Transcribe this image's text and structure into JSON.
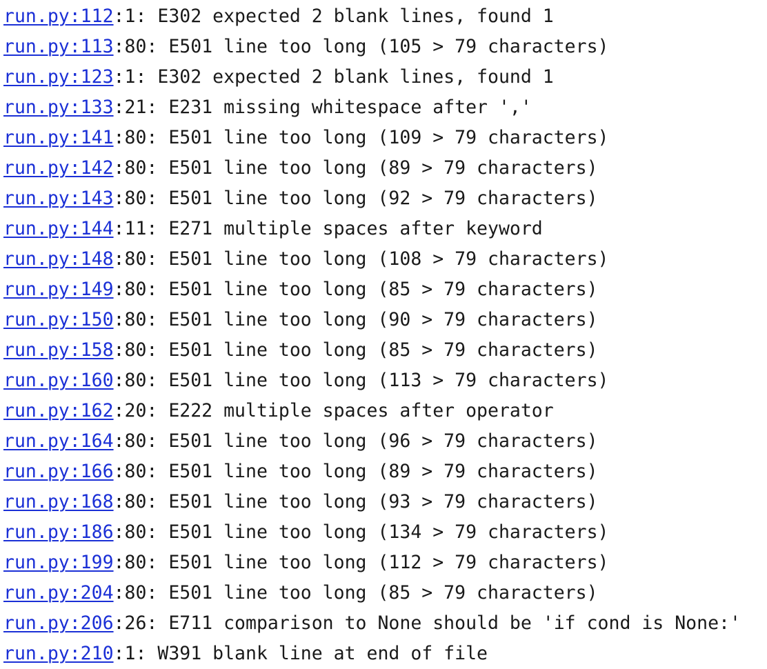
{
  "colors": {
    "link": "#1a2fd6",
    "text": "#1a1a1a",
    "background": "#ffffff"
  },
  "lines": [
    {
      "file": "run.py",
      "line": "112",
      "rest": ":1: E302 expected 2 blank lines, found 1"
    },
    {
      "file": "run.py",
      "line": "113",
      "rest": ":80: E501 line too long (105 > 79 characters)"
    },
    {
      "file": "run.py",
      "line": "123",
      "rest": ":1: E302 expected 2 blank lines, found 1"
    },
    {
      "file": "run.py",
      "line": "133",
      "rest": ":21: E231 missing whitespace after ','"
    },
    {
      "file": "run.py",
      "line": "141",
      "rest": ":80: E501 line too long (109 > 79 characters)"
    },
    {
      "file": "run.py",
      "line": "142",
      "rest": ":80: E501 line too long (89 > 79 characters)"
    },
    {
      "file": "run.py",
      "line": "143",
      "rest": ":80: E501 line too long (92 > 79 characters)"
    },
    {
      "file": "run.py",
      "line": "144",
      "rest": ":11: E271 multiple spaces after keyword"
    },
    {
      "file": "run.py",
      "line": "148",
      "rest": ":80: E501 line too long (108 > 79 characters)"
    },
    {
      "file": "run.py",
      "line": "149",
      "rest": ":80: E501 line too long (85 > 79 characters)"
    },
    {
      "file": "run.py",
      "line": "150",
      "rest": ":80: E501 line too long (90 > 79 characters)"
    },
    {
      "file": "run.py",
      "line": "158",
      "rest": ":80: E501 line too long (85 > 79 characters)"
    },
    {
      "file": "run.py",
      "line": "160",
      "rest": ":80: E501 line too long (113 > 79 characters)"
    },
    {
      "file": "run.py",
      "line": "162",
      "rest": ":20: E222 multiple spaces after operator"
    },
    {
      "file": "run.py",
      "line": "164",
      "rest": ":80: E501 line too long (96 > 79 characters)"
    },
    {
      "file": "run.py",
      "line": "166",
      "rest": ":80: E501 line too long (89 > 79 characters)"
    },
    {
      "file": "run.py",
      "line": "168",
      "rest": ":80: E501 line too long (93 > 79 characters)"
    },
    {
      "file": "run.py",
      "line": "186",
      "rest": ":80: E501 line too long (134 > 79 characters)"
    },
    {
      "file": "run.py",
      "line": "199",
      "rest": ":80: E501 line too long (112 > 79 characters)"
    },
    {
      "file": "run.py",
      "line": "204",
      "rest": ":80: E501 line too long (85 > 79 characters)"
    },
    {
      "file": "run.py",
      "line": "206",
      "rest": ":26: E711 comparison to None should be 'if cond is None:'"
    },
    {
      "file": "run.py",
      "line": "210",
      "rest": ":1: W391 blank line at end of file"
    }
  ]
}
